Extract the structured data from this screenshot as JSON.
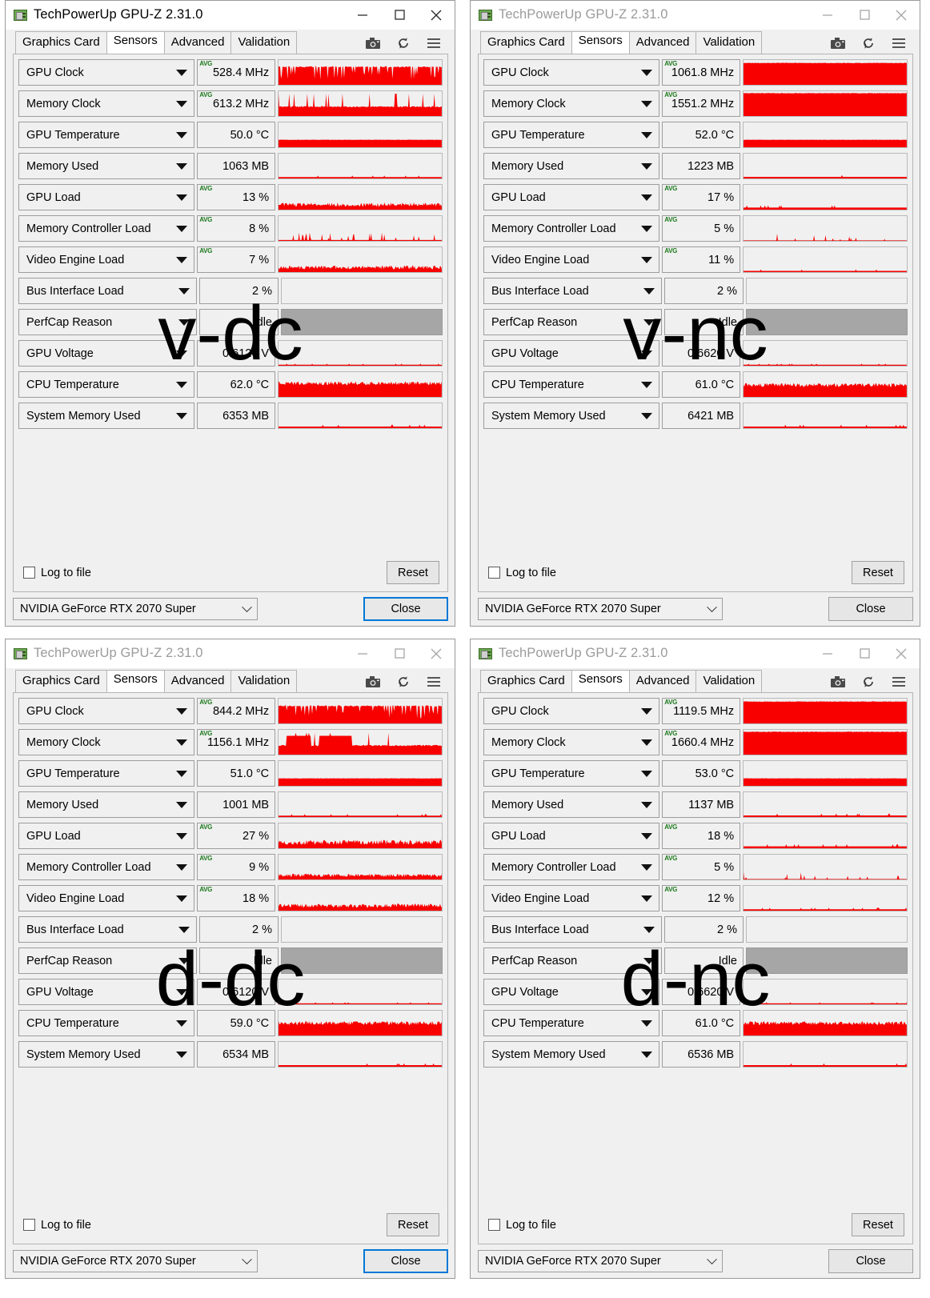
{
  "window": {
    "title": "TechPowerUp GPU-Z 2.31.0",
    "icon": "gpu-card-icon",
    "minimize": "minimize-icon",
    "maximize": "maximize-icon",
    "close": "close-icon"
  },
  "tabs": [
    {
      "label": "Graphics Card",
      "active": false
    },
    {
      "label": "Sensors",
      "active": true
    },
    {
      "label": "Advanced",
      "active": false
    },
    {
      "label": "Validation",
      "active": false
    }
  ],
  "toolbar_icons": [
    {
      "name": "camera-icon"
    },
    {
      "name": "refresh-icon"
    },
    {
      "name": "hamburger-menu-icon"
    }
  ],
  "footer": {
    "log_to_file_label": "Log to file",
    "log_to_file_checked": false,
    "reset_label": "Reset",
    "gpu_select_value": "NVIDIA GeForce RTX 2070 Super",
    "close_label": "Close"
  },
  "colors": {
    "graph_fill": "#f80000",
    "graph_bg": "#f0f0f0",
    "perfcap_bg": "#a6a6a6",
    "avg_badge": "#1f7a1f",
    "focus_blue": "#0078d7",
    "window_bg": "#f0f0f0",
    "title_active": "#000000",
    "title_inactive": "#9b9b9b"
  },
  "sensor_labels": [
    "GPU Clock",
    "Memory Clock",
    "GPU Temperature",
    "Memory Used",
    "GPU Load",
    "Memory Controller Load",
    "Video Engine Load",
    "Bus Interface Load",
    "PerfCap Reason",
    "GPU Voltage",
    "CPU Temperature",
    "System Memory Used"
  ],
  "panels": [
    {
      "id": "v-dc",
      "watermark": "v-dc",
      "active": true,
      "close_focused": true,
      "readings": [
        {
          "label": "GPU Clock",
          "value": "528.4 MHz",
          "avg": true,
          "graph": "spiky-high",
          "level": 0.72
        },
        {
          "label": "Memory Clock",
          "value": "613.2 MHz",
          "avg": true,
          "graph": "blocky-high",
          "level": 0.78
        },
        {
          "label": "GPU Temperature",
          "value": "50.0 °C",
          "avg": false,
          "graph": "flat-band",
          "level": 0.3
        },
        {
          "label": "Memory Used",
          "value": "1063 MB",
          "avg": false,
          "graph": "thin-line",
          "level": 0.1
        },
        {
          "label": "GPU Load",
          "value": "13 %",
          "avg": true,
          "graph": "noisy-low",
          "level": 0.22
        },
        {
          "label": "Memory Controller Load",
          "value": "8 %",
          "avg": true,
          "graph": "sparse-low",
          "level": 0.1
        },
        {
          "label": "Video Engine Load",
          "value": "7 %",
          "avg": true,
          "graph": "noisy-low",
          "level": 0.2
        },
        {
          "label": "Bus Interface Load",
          "value": "2 %",
          "avg": false,
          "graph": "empty",
          "level": 0.0
        },
        {
          "label": "PerfCap Reason",
          "value": "Idle",
          "avg": false,
          "graph": "gray",
          "level": 1.0
        },
        {
          "label": "GPU Voltage",
          "value": "0.6120 V",
          "avg": false,
          "graph": "thin-line",
          "level": 0.07
        },
        {
          "label": "CPU Temperature",
          "value": "62.0 °C",
          "avg": false,
          "graph": "noisy-mid",
          "level": 0.55
        },
        {
          "label": "System Memory Used",
          "value": "6353 MB",
          "avg": false,
          "graph": "thin-line",
          "level": 0.12
        }
      ]
    },
    {
      "id": "v-nc",
      "watermark": "v-nc",
      "active": false,
      "close_focused": false,
      "readings": [
        {
          "label": "GPU Clock",
          "value": "1061.8 MHz",
          "avg": true,
          "graph": "solid-high",
          "level": 0.88
        },
        {
          "label": "Memory Clock",
          "value": "1551.2 MHz",
          "avg": true,
          "graph": "solid-high",
          "level": 0.92
        },
        {
          "label": "GPU Temperature",
          "value": "52.0 °C",
          "avg": false,
          "graph": "flat-band",
          "level": 0.3
        },
        {
          "label": "Memory Used",
          "value": "1223 MB",
          "avg": false,
          "graph": "thin-line",
          "level": 0.12
        },
        {
          "label": "GPU Load",
          "value": "17 %",
          "avg": true,
          "graph": "thin-line",
          "level": 0.15
        },
        {
          "label": "Memory Controller Load",
          "value": "5 %",
          "avg": true,
          "graph": "sparse-low",
          "level": 0.05
        },
        {
          "label": "Video Engine Load",
          "value": "11 %",
          "avg": true,
          "graph": "thin-line",
          "level": 0.09
        },
        {
          "label": "Bus Interface Load",
          "value": "2 %",
          "avg": false,
          "graph": "empty",
          "level": 0.0
        },
        {
          "label": "PerfCap Reason",
          "value": "Idle",
          "avg": false,
          "graph": "gray",
          "level": 1.0
        },
        {
          "label": "GPU Voltage",
          "value": "0.6620 V",
          "avg": false,
          "graph": "thin-line",
          "level": 0.07
        },
        {
          "label": "CPU Temperature",
          "value": "61.0 °C",
          "avg": false,
          "graph": "noisy-mid",
          "level": 0.48
        },
        {
          "label": "System Memory Used",
          "value": "6421 MB",
          "avg": false,
          "graph": "thin-line",
          "level": 0.12
        }
      ]
    },
    {
      "id": "d-dc",
      "watermark": "d-dc",
      "active": false,
      "close_focused": true,
      "readings": [
        {
          "label": "GPU Clock",
          "value": "844.2 MHz",
          "avg": true,
          "graph": "spiky-high",
          "level": 0.7
        },
        {
          "label": "Memory Clock",
          "value": "1156.1 MHz",
          "avg": true,
          "graph": "blocky-high",
          "level": 0.76
        },
        {
          "label": "GPU Temperature",
          "value": "51.0 °C",
          "avg": false,
          "graph": "flat-band",
          "level": 0.3
        },
        {
          "label": "Memory Used",
          "value": "1001 MB",
          "avg": false,
          "graph": "thin-line",
          "level": 0.1
        },
        {
          "label": "GPU Load",
          "value": "27 %",
          "avg": true,
          "graph": "noisy-low",
          "level": 0.26
        },
        {
          "label": "Memory Controller Load",
          "value": "9 %",
          "avg": true,
          "graph": "noisy-low",
          "level": 0.18
        },
        {
          "label": "Video Engine Load",
          "value": "18 %",
          "avg": true,
          "graph": "noisy-low",
          "level": 0.22
        },
        {
          "label": "Bus Interface Load",
          "value": "2 %",
          "avg": false,
          "graph": "empty",
          "level": 0.0
        },
        {
          "label": "PerfCap Reason",
          "value": "Idle",
          "avg": false,
          "graph": "gray",
          "level": 1.0
        },
        {
          "label": "GPU Voltage",
          "value": "0.6120 V",
          "avg": false,
          "graph": "thin-line",
          "level": 0.07
        },
        {
          "label": "CPU Temperature",
          "value": "59.0 °C",
          "avg": false,
          "graph": "noisy-mid",
          "level": 0.5
        },
        {
          "label": "System Memory Used",
          "value": "6534 MB",
          "avg": false,
          "graph": "thin-line",
          "level": 0.12
        }
      ]
    },
    {
      "id": "d-nc",
      "watermark": "d-nc",
      "active": false,
      "close_focused": false,
      "readings": [
        {
          "label": "GPU Clock",
          "value": "1119.5 MHz",
          "avg": true,
          "graph": "solid-high",
          "level": 0.88
        },
        {
          "label": "Memory Clock",
          "value": "1660.4 MHz",
          "avg": true,
          "graph": "solid-high",
          "level": 0.92
        },
        {
          "label": "GPU Temperature",
          "value": "53.0 °C",
          "avg": false,
          "graph": "flat-band",
          "level": 0.3
        },
        {
          "label": "Memory Used",
          "value": "1137 MB",
          "avg": false,
          "graph": "thin-line",
          "level": 0.12
        },
        {
          "label": "GPU Load",
          "value": "18 %",
          "avg": true,
          "graph": "thin-line",
          "level": 0.14
        },
        {
          "label": "Memory Controller Load",
          "value": "5 %",
          "avg": true,
          "graph": "sparse-low",
          "level": 0.06
        },
        {
          "label": "Video Engine Load",
          "value": "12 %",
          "avg": true,
          "graph": "thin-line",
          "level": 0.1
        },
        {
          "label": "Bus Interface Load",
          "value": "2 %",
          "avg": false,
          "graph": "empty",
          "level": 0.0
        },
        {
          "label": "PerfCap Reason",
          "value": "Idle",
          "avg": false,
          "graph": "gray",
          "level": 1.0
        },
        {
          "label": "GPU Voltage",
          "value": "0.6620 V",
          "avg": false,
          "graph": "thin-line",
          "level": 0.07
        },
        {
          "label": "CPU Temperature",
          "value": "61.0 °C",
          "avg": false,
          "graph": "noisy-mid",
          "level": 0.5
        },
        {
          "label": "System Memory Used",
          "value": "6536 MB",
          "avg": false,
          "graph": "thin-line",
          "level": 0.12
        }
      ]
    }
  ]
}
